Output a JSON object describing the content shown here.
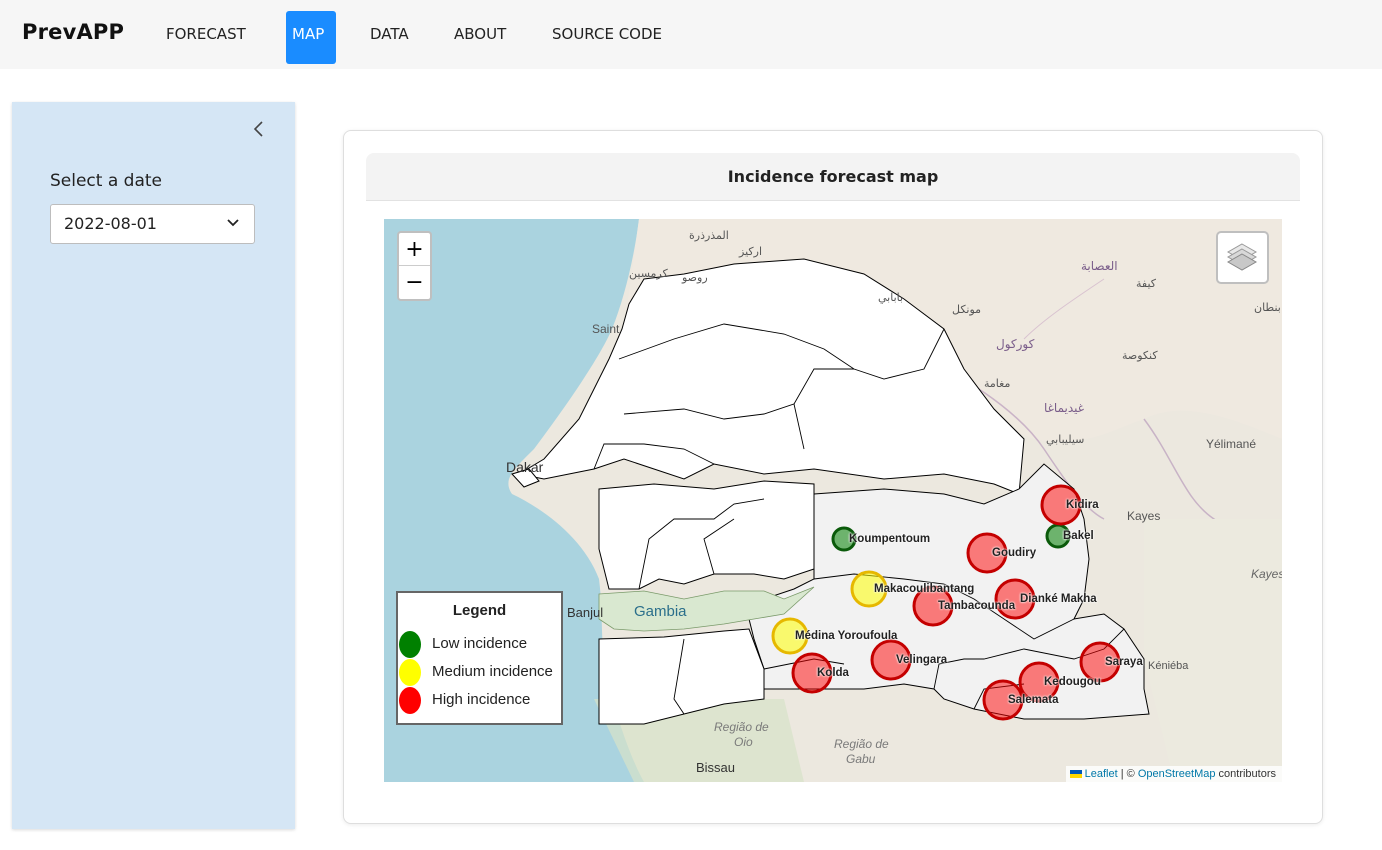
{
  "navbar": {
    "brand": "PrevAPP",
    "items": [
      {
        "label": "FORECAST",
        "active": false
      },
      {
        "label": "MAP",
        "active": true
      },
      {
        "label": "DATA",
        "active": false
      },
      {
        "label": "ABOUT",
        "active": false
      },
      {
        "label": "SOURCE CODE",
        "active": false
      }
    ]
  },
  "sidebar": {
    "collapse_icon": "chevron-left-icon",
    "date_label": "Select a date",
    "date_value": "2022-08-01"
  },
  "card": {
    "title": "Incidence forecast map"
  },
  "map": {
    "zoom_in": "+",
    "zoom_out": "−",
    "layers_icon": "layers-icon",
    "legend": {
      "title": "Legend",
      "items": [
        {
          "label": "Low incidence",
          "color": "#008000"
        },
        {
          "label": "Medium incidence",
          "color": "#ffff00"
        },
        {
          "label": "High incidence",
          "color": "#ff0000"
        }
      ]
    },
    "attribution": {
      "leaflet": "Leaflet",
      "separator": " | © ",
      "osm": "OpenStreetMap",
      "suffix": " contributors"
    },
    "base_labels": {
      "dakar": "Dakar",
      "banjul": "Banjul",
      "gambia": "Gambia",
      "saint": "Saint",
      "kayes": "Kayes",
      "kayes_region": "Kayes",
      "yelimane": "Yélimané",
      "kenieba": "Kéniéba",
      "bissau": "Bissau",
      "regiao_oio_1": "Região de",
      "regiao_oio_2": "Oio",
      "regiao_gabu_1": "Região de",
      "regiao_gabu_2": "Gabu",
      "ar_1": "المذرذرة",
      "ar_2": "اركيز",
      "ar_3": "كرمسين",
      "ar_4": "روصو",
      "ar_5": "بابابي",
      "ar_6": "مونكل",
      "ar_7": "كوركول",
      "ar_8": "مغامة",
      "ar_9": "غيديماغا",
      "ar_10": "سيليبابي",
      "ar_11": "كنكوصة",
      "ar_12": "العصابة",
      "ar_13": "كيفة",
      "ar_14": "بنطان"
    },
    "districts": [
      {
        "name": "Koumpentoum",
        "level": "low",
        "color": "#008000"
      },
      {
        "name": "Bakel",
        "level": "low",
        "color": "#008000"
      },
      {
        "name": "Kidira",
        "level": "high",
        "color": "#ff0000"
      },
      {
        "name": "Goudiry",
        "level": "high",
        "color": "#ff0000"
      },
      {
        "name": "Makacoulibantang",
        "level": "medium",
        "color": "#ffff00"
      },
      {
        "name": "Tambacounda",
        "level": "high",
        "color": "#ff0000"
      },
      {
        "name": "Dianké Makha",
        "level": "high",
        "color": "#ff0000"
      },
      {
        "name": "Médina Yoroufoula",
        "level": "medium",
        "color": "#ffff00"
      },
      {
        "name": "Velingara",
        "level": "high",
        "color": "#ff0000"
      },
      {
        "name": "Kolda",
        "level": "high",
        "color": "#ff0000"
      },
      {
        "name": "Saraya",
        "level": "high",
        "color": "#ff0000"
      },
      {
        "name": "Kedougou",
        "level": "high",
        "color": "#ff0000"
      },
      {
        "name": "Salemata",
        "level": "high",
        "color": "#ff0000"
      }
    ]
  }
}
